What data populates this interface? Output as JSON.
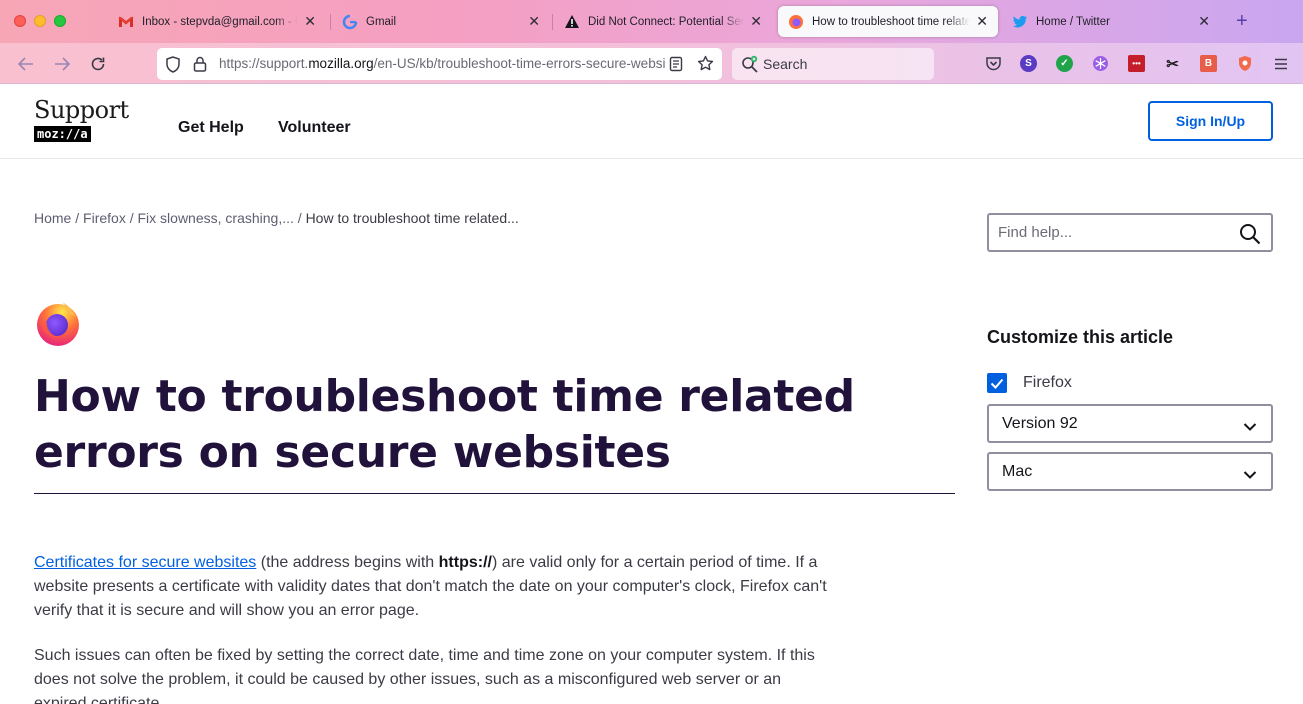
{
  "browser": {
    "tabs": [
      {
        "title": "Inbox - stepvda@gmail.com - Gmail",
        "icon": "gmail-icon",
        "active": false
      },
      {
        "title": "Gmail",
        "icon": "google-icon",
        "active": false
      },
      {
        "title": "Did Not Connect: Potential Security Issue",
        "icon": "warning-icon",
        "active": false
      },
      {
        "title": "How to troubleshoot time related errors",
        "icon": "firefox-icon",
        "active": true
      },
      {
        "title": "Home / Twitter",
        "icon": "twitter-icon",
        "active": false
      }
    ],
    "url_prefix": "https://support.",
    "url_domain": "mozilla.org",
    "url_path": "/en-US/kb/troubleshoot-time-errors-secure-websites",
    "search_placeholder": "Search"
  },
  "header": {
    "logo_word": "Support",
    "logo_brand": "moz://a",
    "nav": [
      "Get Help",
      "Volunteer"
    ],
    "signin_label": "Sign In/Up"
  },
  "breadcrumb": {
    "items": [
      "Home",
      "Firefox",
      "Fix slowness, crashing,..."
    ],
    "current": "How to troubleshoot time related...",
    "separator": " / "
  },
  "search": {
    "placeholder": "Find help..."
  },
  "article": {
    "title": "How to troubleshoot time related errors on secure websites",
    "p1_link": "Certificates for secure websites",
    "p1_a": " (the address begins with ",
    "p1_bold": "https://",
    "p1_b": ") are valid only for a certain period of time. If a website presents a certificate with validity dates that don't match the date on your computer's clock, Firefox can't verify that it is secure and will show you an error page.",
    "p2": "Such issues can often be fixed by setting the correct date, time and time zone on your computer system. If this does not solve the problem, it could be caused by other issues, such as a misconfigured web server or an expired certificate."
  },
  "customize": {
    "title": "Customize this article",
    "product_label": "Firefox",
    "product_checked": true,
    "version": "Version 92",
    "os": "Mac"
  },
  "colors": {
    "accent": "#0060df",
    "title": "#20123a",
    "text": "#3b3b45"
  }
}
